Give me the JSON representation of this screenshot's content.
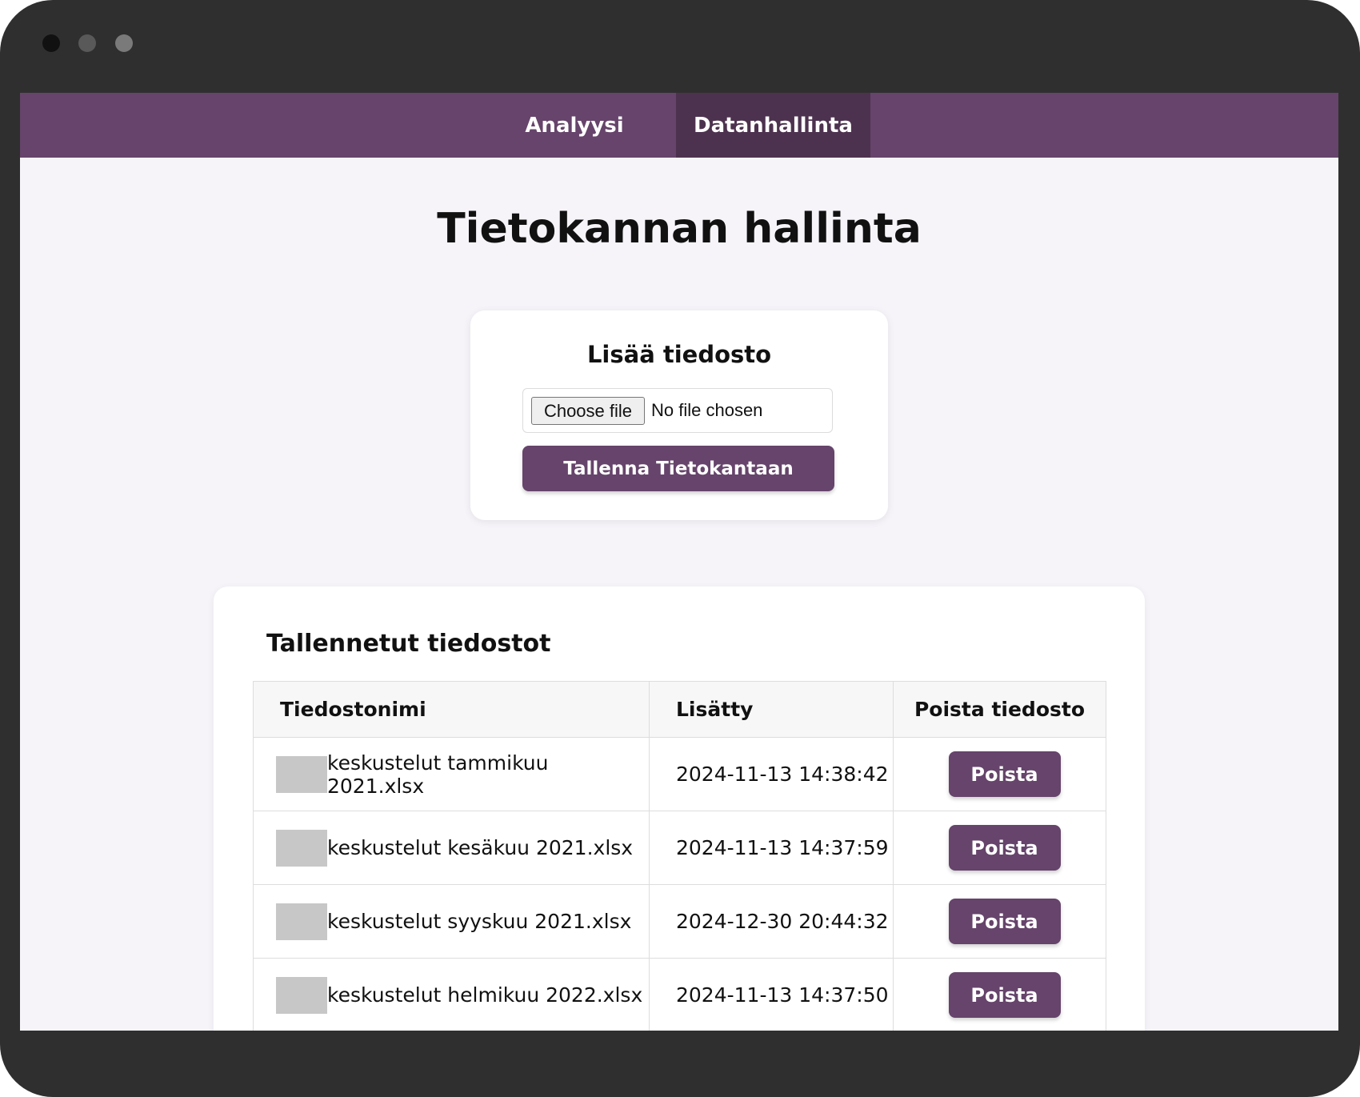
{
  "nav": {
    "tabs": [
      {
        "label": "Analyysi",
        "active": false
      },
      {
        "label": "Datanhallinta",
        "active": true
      }
    ]
  },
  "page": {
    "title": "Tietokannan hallinta"
  },
  "upload": {
    "title": "Lisää tiedosto",
    "choose_label": "Choose file",
    "no_file_label": "No file chosen",
    "save_label": "Tallenna Tietokantaan"
  },
  "files": {
    "title": "Tallennetut tiedostot",
    "columns": [
      "Tiedostonimi",
      "Lisätty",
      "Poista tiedosto"
    ],
    "rows": [
      {
        "name": "keskustelut tammikuu 2021.xlsx",
        "added": "2024-11-13 14:38:42",
        "action": "Poista"
      },
      {
        "name": "keskustelut kesäkuu 2021.xlsx",
        "added": "2024-11-13 14:37:59",
        "action": "Poista"
      },
      {
        "name": "keskustelut syyskuu 2021.xlsx",
        "added": "2024-12-30 20:44:32",
        "action": "Poista"
      },
      {
        "name": "keskustelut helmikuu 2022.xlsx",
        "added": "2024-11-13 14:37:50",
        "action": "Poista"
      }
    ]
  },
  "colors": {
    "accent": "#66446b",
    "accent_dark": "#4d324f",
    "frame": "#2f2f2f",
    "background": "#f6f4f9"
  }
}
